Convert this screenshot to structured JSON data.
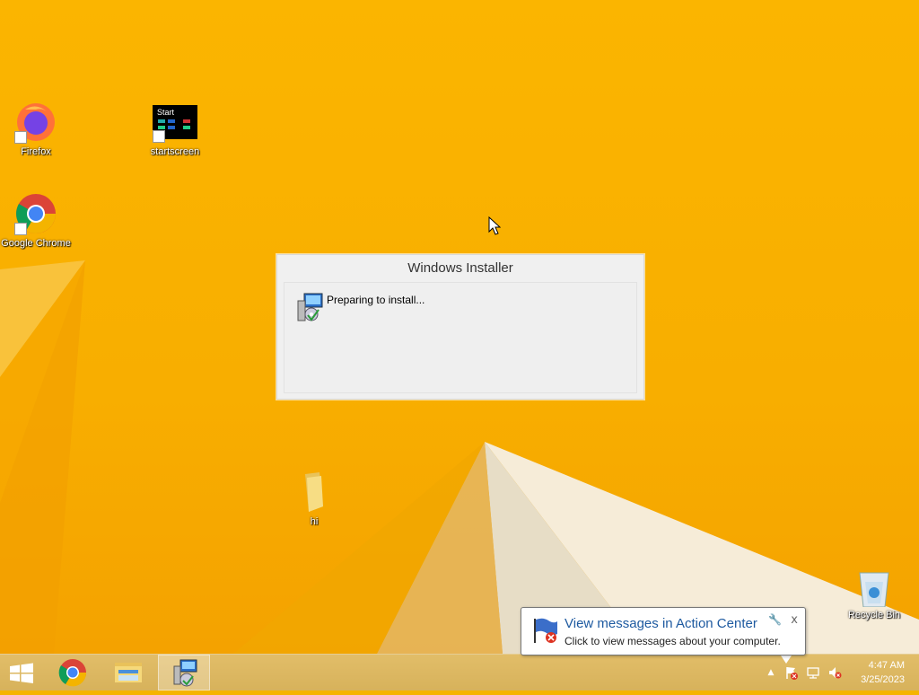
{
  "desktop": {
    "icons": {
      "firefox": "Firefox",
      "startscreen": "startscreen",
      "startscreen_thumb": "Start",
      "chrome": "Google Chrome",
      "folder": "hi",
      "recycle_bin": "Recycle Bin"
    }
  },
  "installer": {
    "title": "Windows Installer",
    "status": "Preparing to install..."
  },
  "notification": {
    "title": "View messages in Action Center",
    "text": "Click to view messages about your computer.",
    "close": "x"
  },
  "taskbar": {
    "time": "4:47 AM",
    "date": "3/25/2023",
    "tray_arrow": "▲"
  },
  "colors": {
    "wallpaper": "#f8ae00",
    "notification_title": "#1e5aa0"
  },
  "icon_names": [
    "firefox-icon",
    "chrome-icon",
    "folder-icon",
    "recycle-bin-icon",
    "windows-installer-icon",
    "action-center-icon",
    "network-icon",
    "volume-muted-icon",
    "start-icon",
    "file-explorer-icon"
  ]
}
